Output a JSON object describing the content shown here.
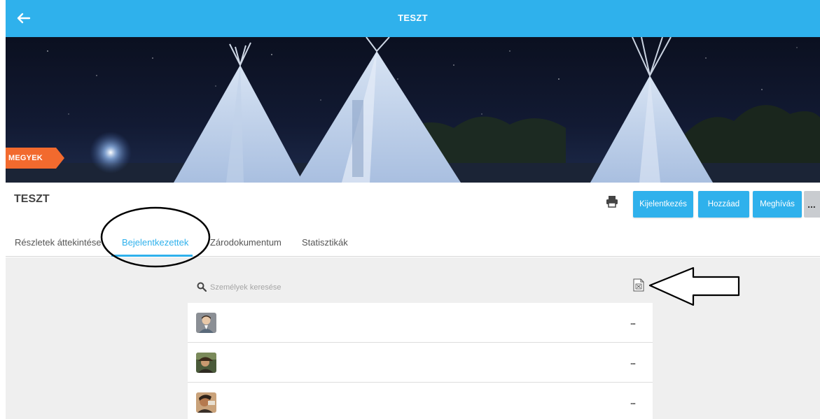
{
  "topbar": {
    "title": "TESZT",
    "back_icon": "arrow-left-icon"
  },
  "banner": {
    "ribbon_label": "MEGYEK"
  },
  "header": {
    "title": "TESZT",
    "buttons": [
      {
        "label": "Kijelentkezés"
      },
      {
        "label": "Hozzáad"
      },
      {
        "label": "Meghívás"
      }
    ],
    "more_label": "..."
  },
  "tabs": [
    {
      "label": "Részletek áttekintése"
    },
    {
      "label": "Bejelentkezettek"
    },
    {
      "label": "Zárodokumentum"
    },
    {
      "label": "Statisztikák"
    }
  ],
  "search": {
    "placeholder": "Személyek keresése"
  },
  "people": [
    {
      "more_label": "..."
    },
    {
      "more_label": "..."
    },
    {
      "more_label": "..."
    }
  ],
  "colors": {
    "accent": "#2fb1ec",
    "ribbon": "#f26a2e",
    "background": "#efefef"
  }
}
